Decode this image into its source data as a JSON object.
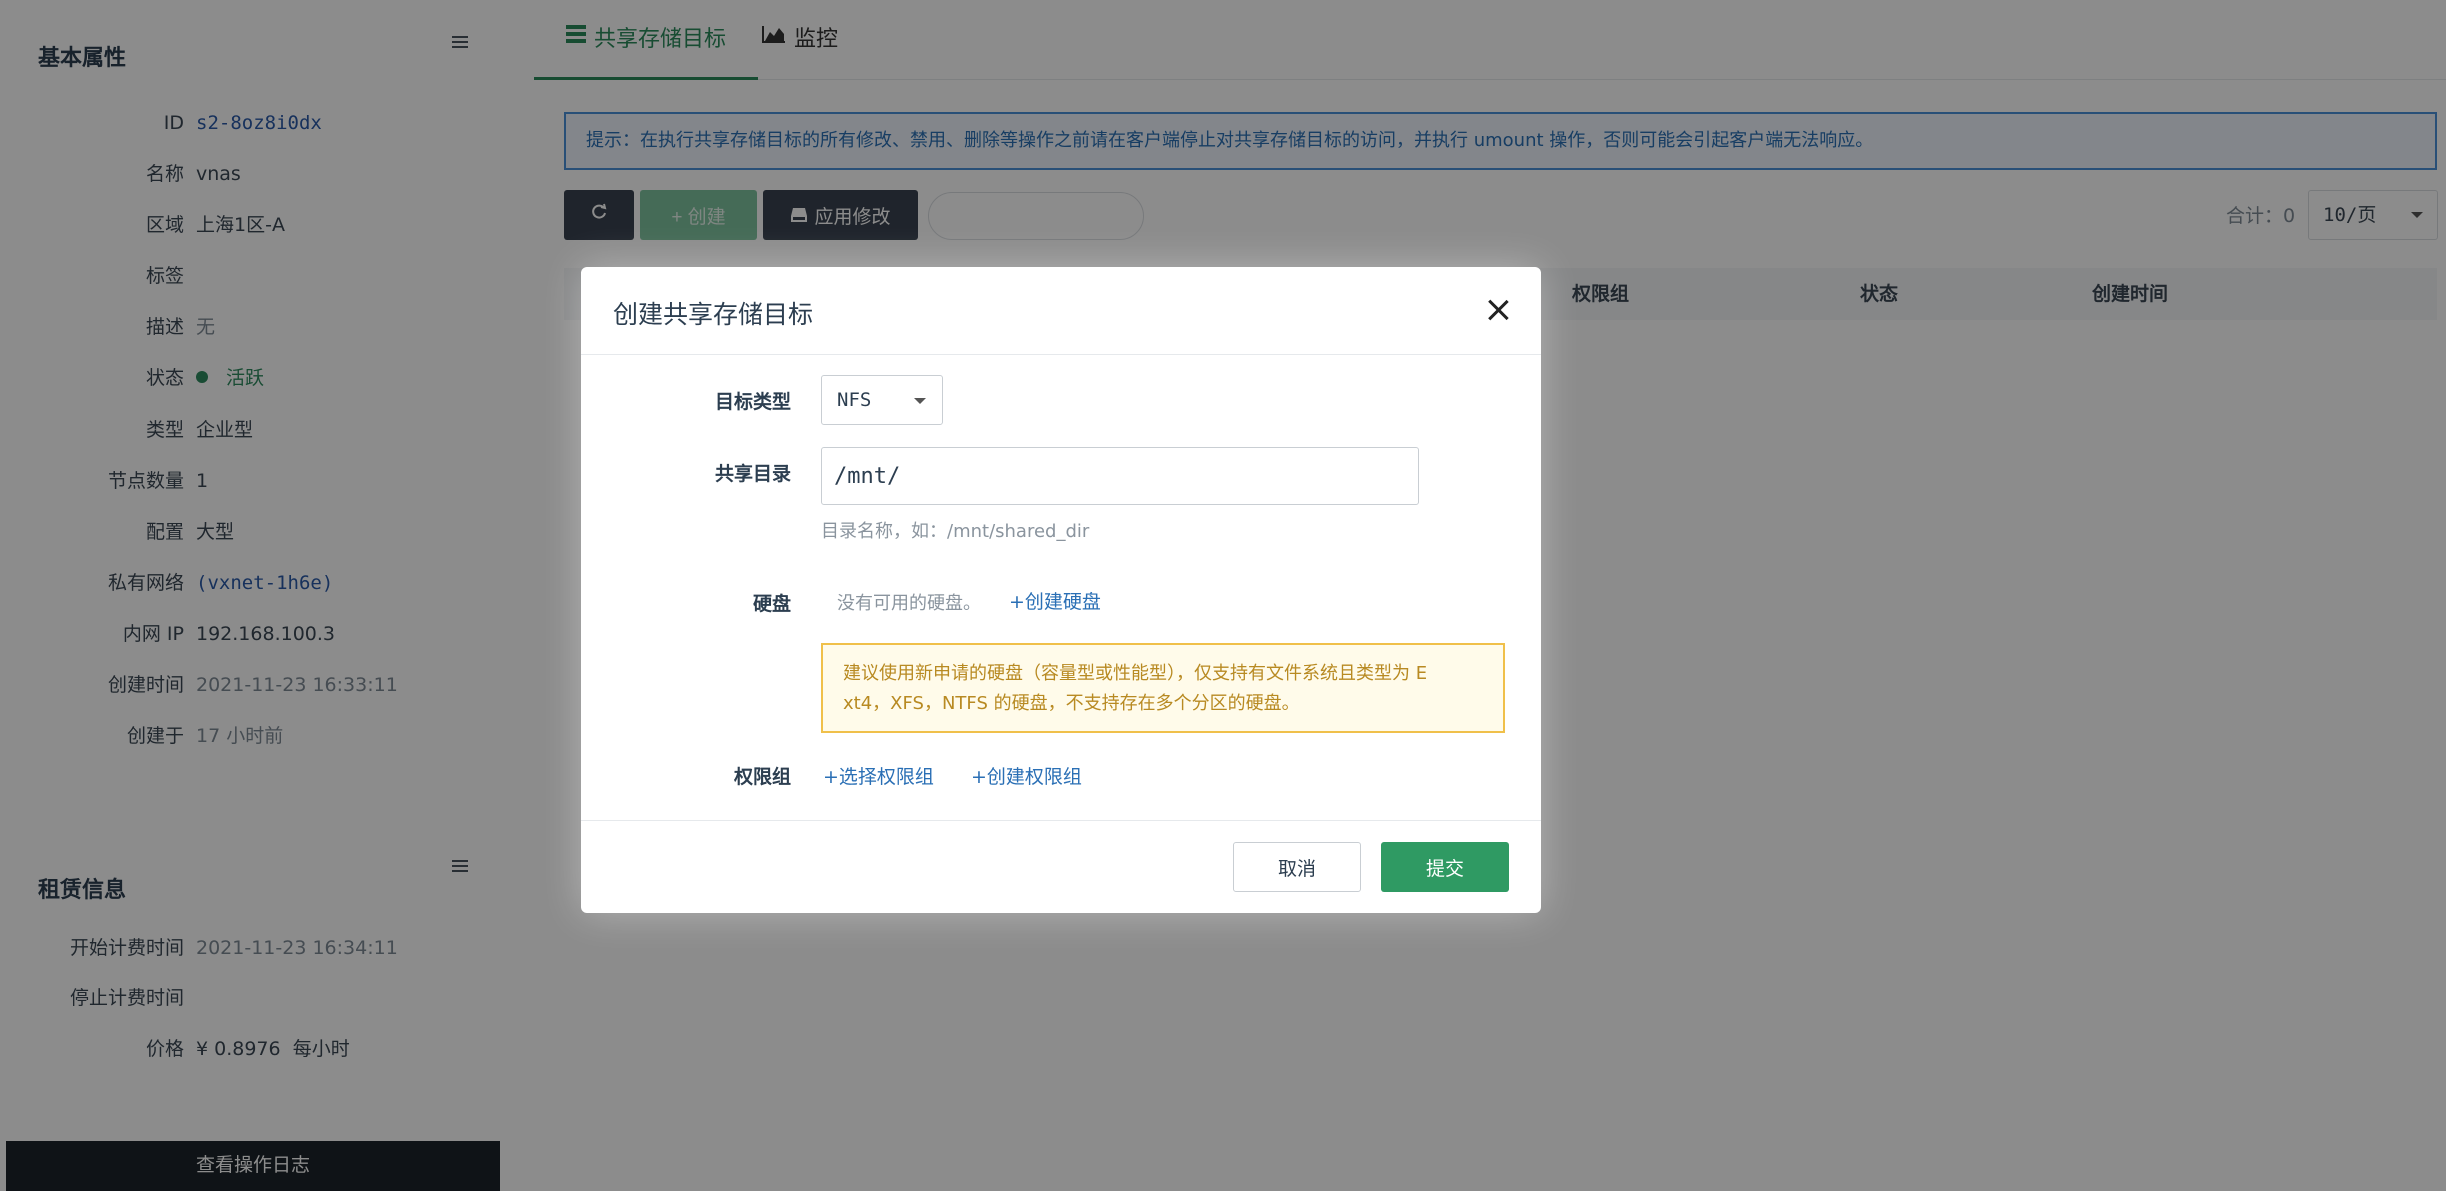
{
  "basic_panel": {
    "title": "基本属性",
    "menu_icon": "hamburger-menu-icon",
    "rows": [
      {
        "label": "ID",
        "value": "s2-8oz8i0dx"
      },
      {
        "label": "名称",
        "value": "vnas"
      },
      {
        "label": "区域",
        "value": "上海1区-A"
      },
      {
        "label": "标签",
        "value": ""
      },
      {
        "label": "描述",
        "value": "无"
      },
      {
        "label": "状态",
        "value": "活跃"
      },
      {
        "label": "类型",
        "value": "企业型"
      },
      {
        "label": "节点数量",
        "value": "1"
      },
      {
        "label": "配置",
        "value": "大型"
      },
      {
        "label": "私有网络",
        "value": "(vxnet-1h6e)"
      },
      {
        "label": "内网 IP",
        "value": "192.168.100.3"
      },
      {
        "label": "创建时间",
        "value": "2021-11-23 16:33:11"
      },
      {
        "label": "创建于",
        "value": "17 小时前"
      }
    ]
  },
  "lease_panel": {
    "title": "租赁信息",
    "rows": [
      {
        "label": "开始计费时间",
        "value": "2021-11-23 16:34:11"
      },
      {
        "label": "停止计费时间",
        "value": ""
      },
      {
        "label": "价格",
        "value": "¥ 0.8976  每小时"
      }
    ]
  },
  "log_button_label": "查看操作日志",
  "tabs": [
    {
      "label": "共享存储目标",
      "icon": "storage-icon",
      "active": true
    },
    {
      "label": "监控",
      "icon": "area-chart-icon",
      "active": false
    }
  ],
  "tip": "提示：在执行共享存储目标的所有修改、禁用、删除等操作之前请在客户端停止对共享存储目标的访问，并执行 umount 操作，否则可能会引起客户端无法响应。",
  "toolbar": {
    "refresh_icon": "refresh-icon",
    "create_label": "+ 创建",
    "apply_label": "应用修改",
    "apply_icon": "disk-icon",
    "total": "合计：0",
    "page_size": "10/页"
  },
  "table": {
    "columns": [
      "权限组",
      "状态",
      "创建时间"
    ]
  },
  "modal": {
    "title": "创建共享存储目标",
    "target_type_label": "目标类型",
    "target_type_value": "NFS",
    "share_dir_label": "共享目录",
    "share_dir_value": "/mnt/",
    "share_dir_hint": "目录名称，如：/mnt/shared_dir",
    "disk_label": "硬盘",
    "no_disk_text": "没有可用的硬盘。",
    "create_disk_link": "+创建硬盘",
    "warning_line1": "建议使用新申请的硬盘（容量型或性能型），仅支持有文件系统且类型为 E",
    "warning_line2": "xt4，XFS，NTFS 的硬盘，不支持存在多个分区的硬盘。",
    "perm_label": "权限组",
    "select_perm_link": "+选择权限组",
    "create_perm_link": "+创建权限组",
    "cancel_label": "取消",
    "submit_label": "提交"
  },
  "colors": {
    "accent_green": "#2f9a63",
    "link_blue": "#2a6fb5",
    "warning_yellow": "#f0c04a"
  }
}
